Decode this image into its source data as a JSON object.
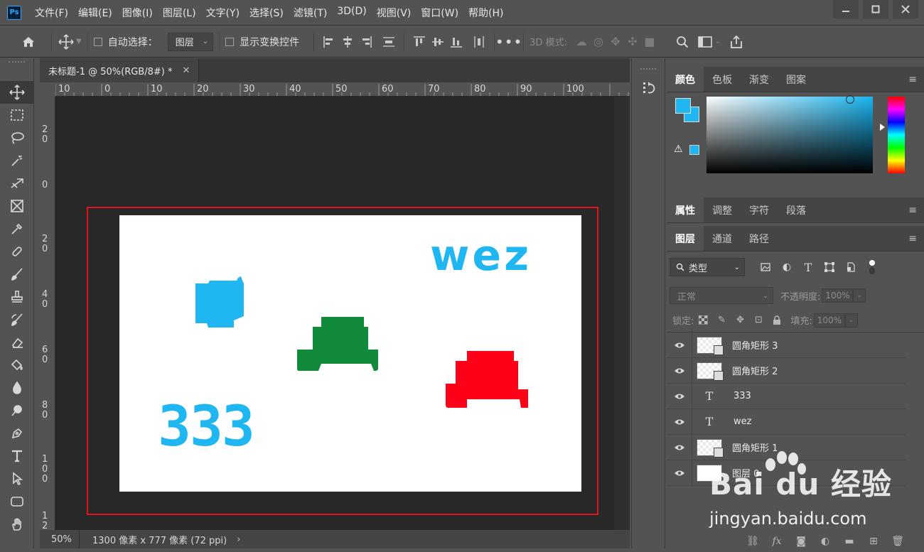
{
  "app": {
    "logo_text": "Ps",
    "menu": [
      "文件(F)",
      "编辑(E)",
      "图像(I)",
      "图层(L)",
      "文字(Y)",
      "选择(S)",
      "滤镜(T)",
      "3D(D)",
      "视图(V)",
      "窗口(W)",
      "帮助(H)"
    ],
    "window_controls": [
      "minimize-icon",
      "maximize-icon",
      "close-icon"
    ]
  },
  "options_bar": {
    "auto_select_label": "自动选择：",
    "auto_select_target": "图层",
    "show_transform_label": "显示变换控件",
    "mode_3d_label": "3D 模式:"
  },
  "document": {
    "tab_title": "未标题-1 @ 50%(RGB/8#) *",
    "zoom": "50%",
    "info": "1300 像素 x 777 像素 (72 ppi)",
    "info_arrow": "›",
    "ruler_top_labels": [
      "10",
      "0",
      "10",
      "20",
      "30",
      "40",
      "50",
      "60",
      "70",
      "80",
      "90",
      "100"
    ],
    "ruler_left_labels": [
      "2\n0",
      "0",
      "2\n0",
      "4\n0",
      "6\n0",
      "8\n0",
      "1\n0\n0",
      "1\n2"
    ],
    "canvas_text_1": "wez",
    "canvas_text_2": "333",
    "colors": {
      "blue": "#1fb6f2",
      "green": "#128a3c",
      "red": "#ff0019",
      "selection": "#e0141b"
    }
  },
  "color_panel": {
    "tabs": [
      "颜色",
      "色板",
      "渐变",
      "图案"
    ],
    "active_tab": "颜色",
    "foreground": "#1fb6f2",
    "background": "#1fb6f2"
  },
  "properties_panel": {
    "tabs": [
      "属性",
      "调整",
      "字符",
      "段落"
    ],
    "active_tab": "属性"
  },
  "layers_panel": {
    "tabs": [
      "图层",
      "通道",
      "路径"
    ],
    "active_tab": "图层",
    "filter_type": "类型",
    "blend_mode": "正常",
    "opacity_label": "不透明度:",
    "opacity_value": "100%",
    "lock_label": "锁定:",
    "fill_label": "填充:",
    "fill_value": "100%",
    "layers": [
      {
        "name": "圆角矩形 3",
        "kind": "shape"
      },
      {
        "name": "圆角矩形 2",
        "kind": "shape"
      },
      {
        "name": "333",
        "kind": "text"
      },
      {
        "name": "wez",
        "kind": "text"
      },
      {
        "name": "圆角矩形 1",
        "kind": "shape"
      },
      {
        "name": "图层 0",
        "kind": "pixel"
      }
    ]
  },
  "watermark": {
    "brand": "Bai du 经验",
    "url": "jingyan.baidu.com"
  }
}
